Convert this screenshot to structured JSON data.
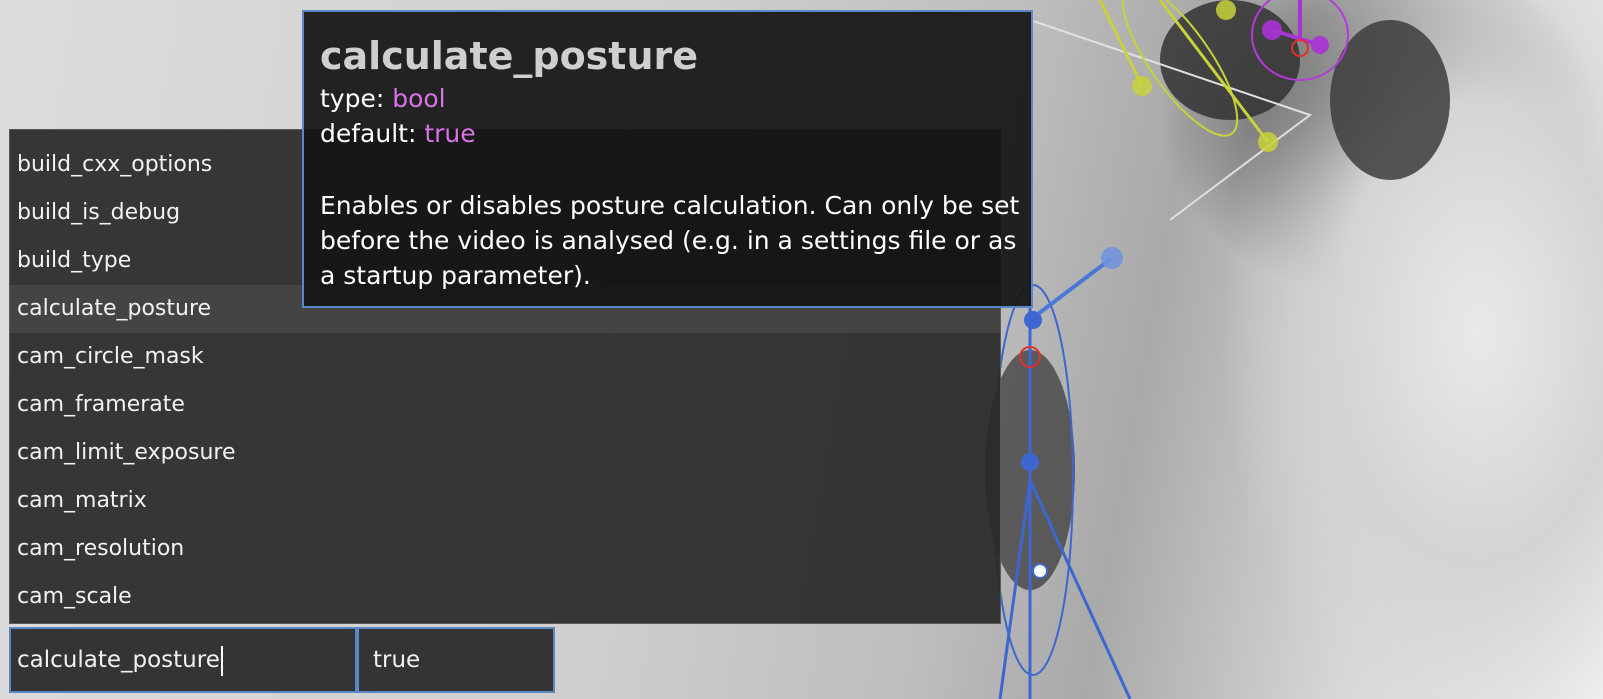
{
  "colors": {
    "panel_bg": "#282828",
    "accent_border": "#5c86c4",
    "tooltip_value": "#d873e6",
    "text": "#f2f2f2"
  },
  "settings_list": {
    "items": [
      "build_cxx_options",
      "build_is_debug",
      "build_type",
      "calculate_posture",
      "cam_circle_mask",
      "cam_framerate",
      "cam_limit_exposure",
      "cam_matrix",
      "cam_resolution",
      "cam_scale"
    ],
    "selected": "calculate_posture"
  },
  "tooltip": {
    "title": "calculate_posture",
    "type_label": "type: ",
    "type_value": "bool",
    "default_label": "default: ",
    "default_value": "true",
    "description": "Enables or disables posture calculation. Can only be set before the video is analysed (e.g. in a settings file or as a startup parameter)."
  },
  "input": {
    "name_value": "calculate_posture",
    "value_value": "true"
  }
}
